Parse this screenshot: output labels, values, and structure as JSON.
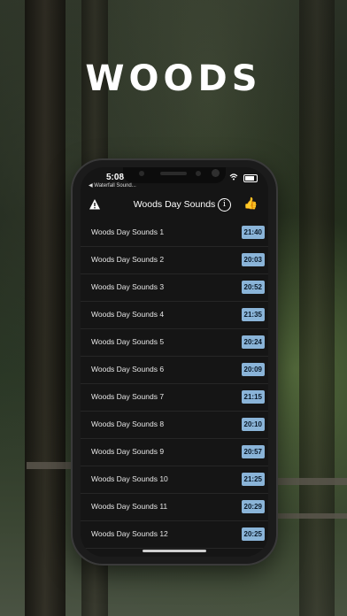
{
  "app": {
    "brand_title": "WOODS"
  },
  "status_bar": {
    "time": "5:08",
    "back_app": "◀ Waterfall Sound..."
  },
  "navbar": {
    "title": "Woods Day Sounds",
    "left_icon": "warning-icon",
    "right_icons": [
      "info-icon",
      "thumbs-up-icon"
    ]
  },
  "tracks": [
    {
      "label": "Woods Day Sounds 1",
      "duration": "21:40"
    },
    {
      "label": "Woods Day Sounds 2",
      "duration": "20:03"
    },
    {
      "label": "Woods Day Sounds 3",
      "duration": "20:52"
    },
    {
      "label": "Woods Day Sounds 4",
      "duration": "21:35"
    },
    {
      "label": "Woods Day Sounds 5",
      "duration": "20:24"
    },
    {
      "label": "Woods Day Sounds 6",
      "duration": "20:09"
    },
    {
      "label": "Woods Day Sounds 7",
      "duration": "21:15"
    },
    {
      "label": "Woods Day Sounds 8",
      "duration": "20:10"
    },
    {
      "label": "Woods Day Sounds 9",
      "duration": "20:57"
    },
    {
      "label": "Woods Day Sounds 10",
      "duration": "21:25"
    },
    {
      "label": "Woods Day Sounds 11",
      "duration": "20:29"
    },
    {
      "label": "Woods Day Sounds 12",
      "duration": "20:25"
    }
  ],
  "colors": {
    "duration_badge_bg": "#8ab4d8",
    "screen_bg": "#151515",
    "thumbs_up": "#f0b020"
  }
}
